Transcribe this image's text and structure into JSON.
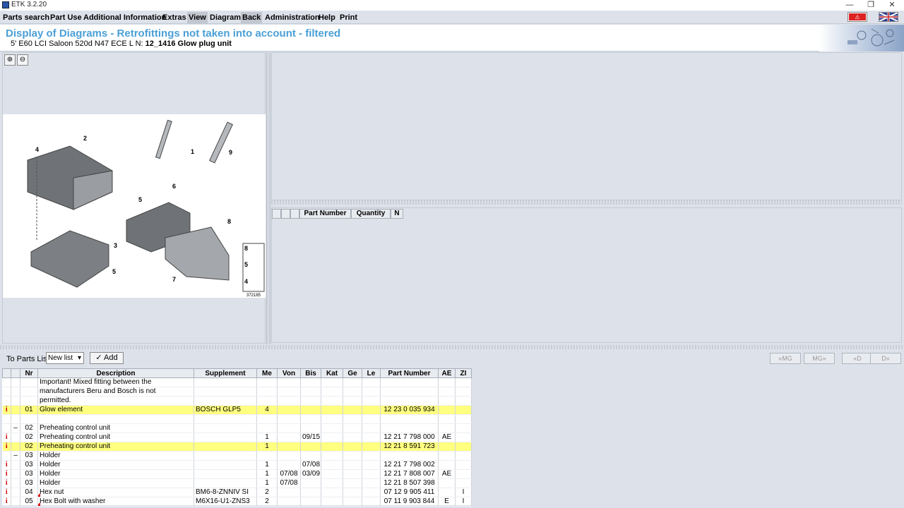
{
  "window": {
    "title": "ETK 3.2.20",
    "minimize": "—",
    "restore": "❐",
    "close": "✕"
  },
  "menu": [
    "Parts search",
    "Part Use",
    "Additional Information",
    "Extras",
    "View",
    "Diagram",
    "Back",
    "Administration",
    "Help",
    "Print"
  ],
  "header": {
    "title": "Display of Diagrams - Retrofittings not taken into account - filtered",
    "vehicle": "5' E60 LCI Saloon 520d N47 ECE",
    "ln_label": "L N:",
    "group": "12_1416 Glow plug unit"
  },
  "diagram": {
    "zoom_in": "⊕",
    "zoom_out": "⊖",
    "callouts": [
      "1",
      "2",
      "3",
      "4",
      "5",
      "6",
      "7",
      "8",
      "9",
      "5"
    ],
    "legend_items": [
      "8",
      "5",
      "4"
    ],
    "image_number": "372185"
  },
  "parts_table": {
    "columns": [
      "Part Number",
      "Quantity",
      "N"
    ]
  },
  "toolbar": {
    "to_parts_list": "To Parts List",
    "list_select": "New list",
    "add": "✓ Add",
    "nav": [
      "«MG",
      "MG»",
      "«D",
      "D»"
    ]
  },
  "grid": {
    "columns": [
      "",
      "",
      "Nr",
      "Description",
      "Supplement",
      "Me",
      "Von",
      "Bis",
      "Kat",
      "Ge",
      "Le",
      "Part Number",
      "AE",
      "ZI"
    ],
    "rows": [
      {
        "i": "",
        "x": "",
        "nr": "",
        "desc": "Important! Mixed fitting between the",
        "sup": "",
        "me": "",
        "von": "",
        "bis": "",
        "pn": "",
        "ae": "",
        "zi": "",
        "hl": false
      },
      {
        "i": "",
        "x": "",
        "nr": "",
        "desc": "manufacturers Beru and Bosch is not",
        "sup": "",
        "me": "",
        "von": "",
        "bis": "",
        "pn": "",
        "ae": "",
        "zi": "",
        "hl": false
      },
      {
        "i": "",
        "x": "",
        "nr": "",
        "desc": "permitted.",
        "sup": "",
        "me": "",
        "von": "",
        "bis": "",
        "pn": "",
        "ae": "",
        "zi": "",
        "hl": false
      },
      {
        "i": "i",
        "x": "",
        "nr": "01",
        "desc": "Glow element",
        "sup": "BOSCH GLP5",
        "me": "4",
        "von": "",
        "bis": "",
        "pn": "12 23 0 035 934",
        "ae": "",
        "zi": "",
        "hl": true
      },
      {
        "i": "",
        "x": "",
        "nr": "",
        "desc": "",
        "sup": "",
        "me": "",
        "von": "",
        "bis": "",
        "pn": "",
        "ae": "",
        "zi": "",
        "hl": false
      },
      {
        "i": "",
        "x": "–",
        "nr": "02",
        "desc": "Preheating control unit",
        "sup": "",
        "me": "",
        "von": "",
        "bis": "",
        "pn": "",
        "ae": "",
        "zi": "",
        "hl": false
      },
      {
        "i": "i",
        "x": "",
        "nr": "02",
        "desc": "Preheating control unit",
        "sup": "",
        "me": "1",
        "von": "",
        "bis": "09/15",
        "pn": "12 21 7 798 000",
        "ae": "AE",
        "zi": "",
        "hl": false
      },
      {
        "i": "i",
        "x": "",
        "nr": "02",
        "desc": "Preheating control unit",
        "sup": "",
        "me": "1",
        "von": "",
        "bis": "",
        "pn": "12 21 8 591 723",
        "ae": "",
        "zi": "",
        "hl": true
      },
      {
        "i": "",
        "x": "–",
        "nr": "03",
        "desc": "Holder",
        "sup": "",
        "me": "",
        "von": "",
        "bis": "",
        "pn": "",
        "ae": "",
        "zi": "",
        "hl": false
      },
      {
        "i": "i",
        "x": "",
        "nr": "03",
        "desc": "Holder",
        "sup": "",
        "me": "1",
        "von": "",
        "bis": "07/08",
        "pn": "12 21 7 798 002",
        "ae": "",
        "zi": "",
        "hl": false
      },
      {
        "i": "i",
        "x": "",
        "nr": "03",
        "desc": "Holder",
        "sup": "",
        "me": "1",
        "von": "07/08",
        "bis": "03/09",
        "pn": "12 21 7 808 007",
        "ae": "AE",
        "zi": "",
        "hl": false
      },
      {
        "i": "i",
        "x": "",
        "nr": "03",
        "desc": "Holder",
        "sup": "",
        "me": "1",
        "von": "07/08",
        "bis": "",
        "pn": "12 21 8 507 398",
        "ae": "",
        "zi": "",
        "hl": false
      },
      {
        "i": "i",
        "x": "",
        "nr": "04",
        "desc": "Hex nut",
        "sup": "BM6-8-ZNNIV SI",
        "me": "2",
        "von": "",
        "bis": "",
        "pn": "07 12 9 905 411",
        "ae": "",
        "zi": "I",
        "hl": false,
        "mark": true
      },
      {
        "i": "i",
        "x": "",
        "nr": "05",
        "desc": "Hex Bolt with washer",
        "sup": "M6X16-U1-ZNS3",
        "me": "2",
        "von": "",
        "bis": "",
        "pn": "07 11 9 903 844",
        "ae": "E",
        "zi": "I",
        "hl": false,
        "mark": true
      }
    ]
  }
}
